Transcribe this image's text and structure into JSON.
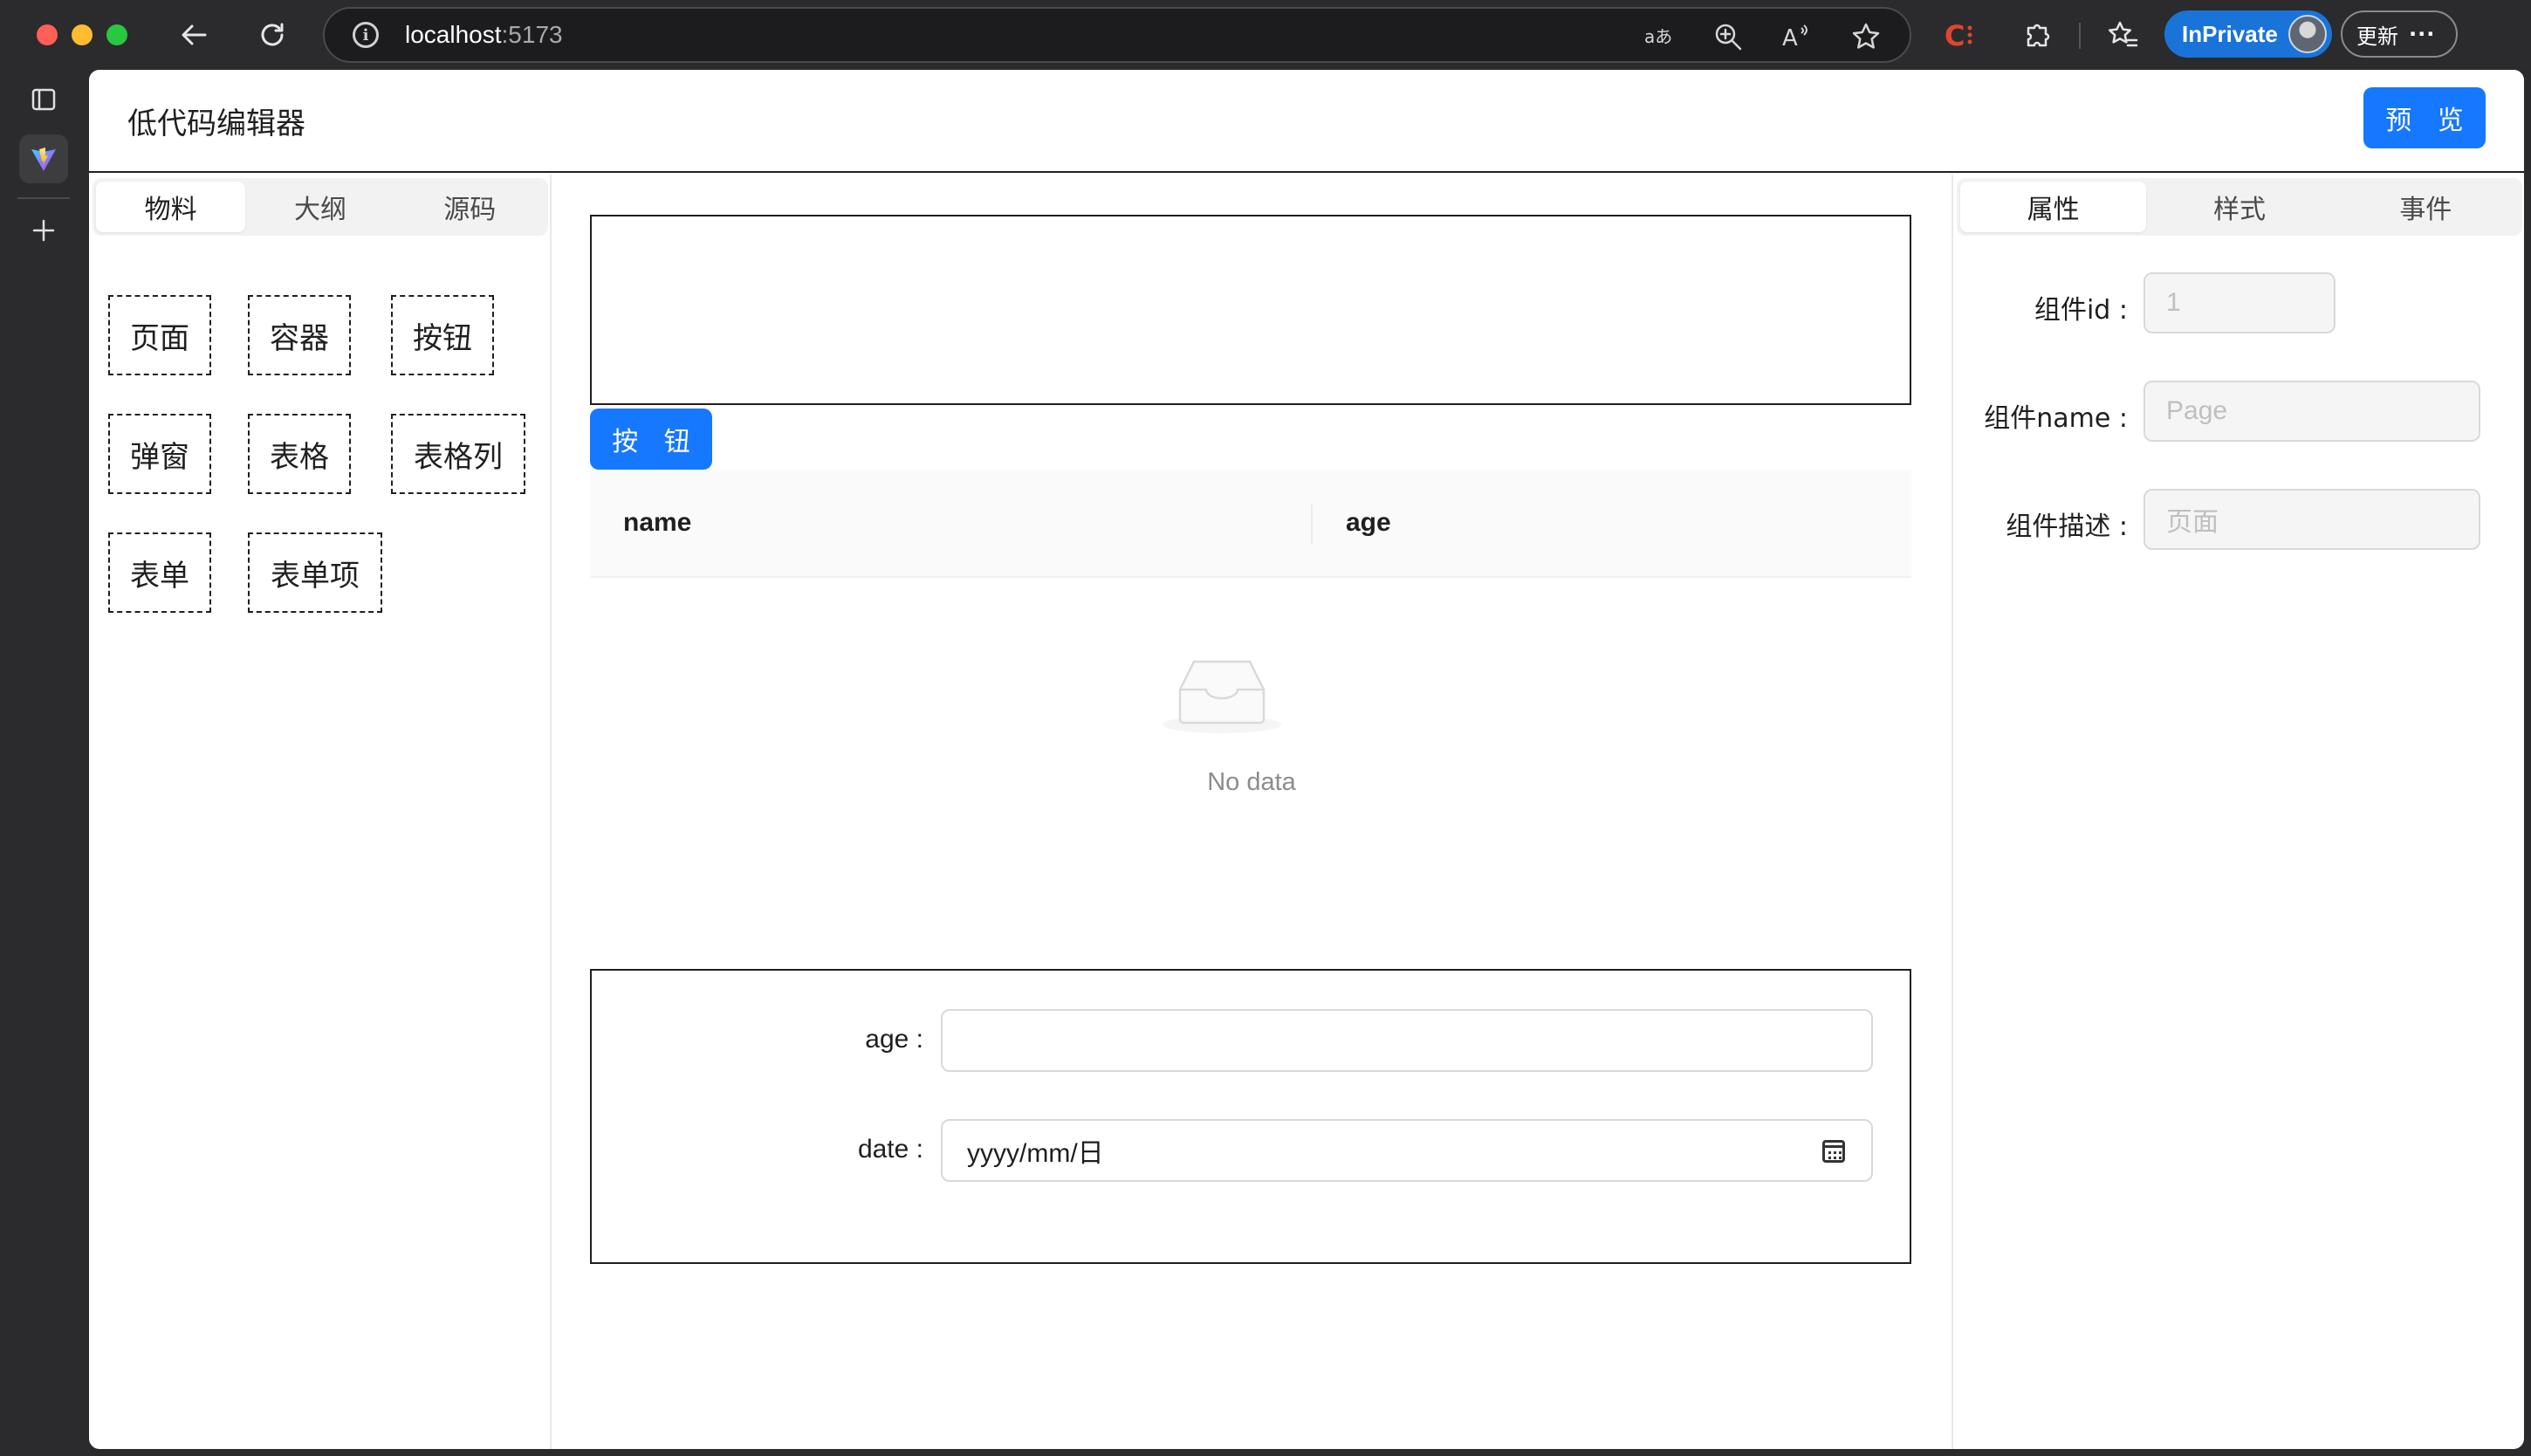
{
  "browser": {
    "url_host": "localhost",
    "url_port": ":5173",
    "inprivate_label": "InPrivate",
    "update_label": "更新",
    "more_label": "···"
  },
  "app": {
    "title": "低代码编辑器",
    "preview_button": "预 览"
  },
  "left_panel": {
    "tabs": [
      "物料",
      "大纲",
      "源码"
    ],
    "active_tab": 0,
    "materials": [
      "页面",
      "容器",
      "按钮",
      "弹窗",
      "表格",
      "表格列",
      "表单",
      "表单项"
    ]
  },
  "canvas": {
    "button_label": "按 钮",
    "table": {
      "columns": [
        "name",
        "age"
      ],
      "empty_text": "No data"
    },
    "form": {
      "fields": [
        {
          "label": "age",
          "value": ""
        },
        {
          "label": "date",
          "value": "yyyy/mm/日"
        }
      ]
    }
  },
  "right_panel": {
    "tabs": [
      "属性",
      "样式",
      "事件"
    ],
    "active_tab": 0,
    "properties": [
      {
        "label": "组件id",
        "placeholder": "1"
      },
      {
        "label": "组件name",
        "placeholder": "Page"
      },
      {
        "label": "组件描述",
        "placeholder": "页面"
      }
    ]
  },
  "colors": {
    "primary": "#1677ff",
    "inprivate": "#1a73d9"
  }
}
